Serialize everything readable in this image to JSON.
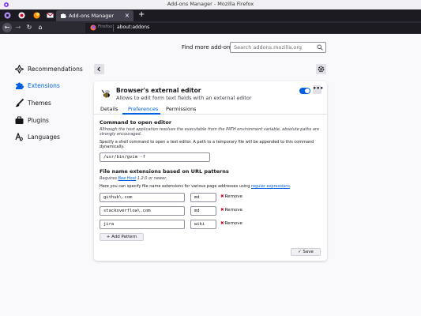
{
  "window": {
    "title": "Add-ons Manager - Mozilla Firefox"
  },
  "tabs": [
    {
      "title": "Add-ons Manager",
      "close": "×"
    }
  ],
  "newtab_glyph": "+",
  "nav": {
    "back": "←",
    "forward": "→",
    "reload": "↻",
    "home": "⌂"
  },
  "urlbar": {
    "identity": "Firefox",
    "url": "about:addons"
  },
  "sidebar": {
    "items": [
      {
        "label": "Recommendations",
        "icon": "recommendations-icon",
        "active": false
      },
      {
        "label": "Extensions",
        "icon": "puzzle-piece-icon",
        "active": true
      },
      {
        "label": "Themes",
        "icon": "paintbrush-icon",
        "active": false
      },
      {
        "label": "Plugins",
        "icon": "briefcase-icon",
        "active": false
      },
      {
        "label": "Languages",
        "icon": "languages-icon",
        "active": false
      }
    ]
  },
  "find": {
    "label": "Find more add-ons",
    "placeholder": "Search addons.mozilla.org"
  },
  "addon": {
    "name": "Browser's external editor",
    "description": "Allows to edit form text fields with an external editor",
    "enabled": true,
    "more": "•••"
  },
  "detail_tabs": [
    {
      "label": "Details",
      "active": false
    },
    {
      "label": "Preferences",
      "active": true
    },
    {
      "label": "Permissions",
      "active": false
    }
  ],
  "prefs": {
    "command_title": "Command to open editor",
    "command_note_1": "Although the host application resolves the executable from the PATH environment variable, absolute paths are",
    "command_note_2": "strongly encouraged.",
    "command_help_1": "Specify a shell command to open a text editor. A path to a temporary file will be appended to this command",
    "command_help_2": "dynamically.",
    "command_value": "/usr/bin/gvim -f",
    "patterns_title": "File name extensions based on URL patterns",
    "requires_prefix": "Requires ",
    "requires_link": "Bee Host",
    "requires_suffix": " 1.2.0 or newer.",
    "patterns_help_prefix": "Here you can specify file name extensions for various page addresses using ",
    "patterns_help_link": "regular expressions",
    "patterns_help_suffix": ".",
    "rows": [
      {
        "pattern": "github\\.com",
        "ext": "md",
        "remove": "Remove"
      },
      {
        "pattern": "stackoverflow\\.com",
        "ext": "md",
        "remove": "Remove"
      },
      {
        "pattern": "jira",
        "ext": "wiki",
        "remove": "Remove"
      }
    ],
    "add_pattern": "+ Add Pattern",
    "save": "✓ Save"
  },
  "colors": {
    "accent": "#0061e0",
    "remove": "#d70022",
    "tabbar": "#1c1b22",
    "navbar": "#2b2a33"
  }
}
